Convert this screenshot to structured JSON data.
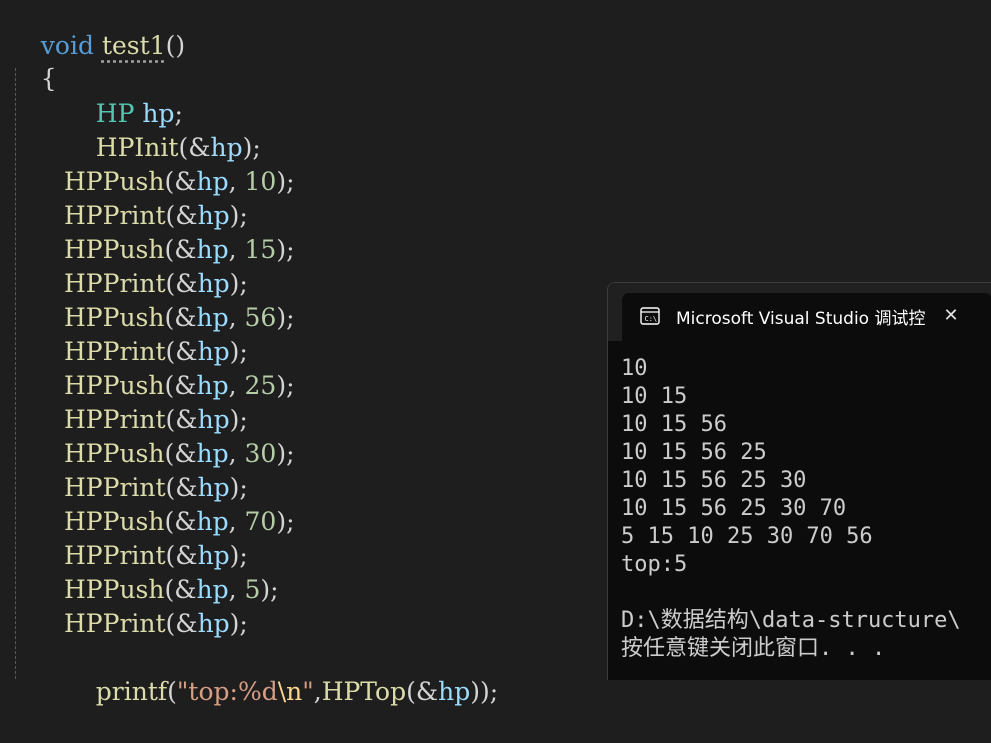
{
  "editor": {
    "fn_header": {
      "kw": "void",
      "name": "test1",
      "parens": "()"
    },
    "open_brace": "{",
    "decl": {
      "type": "HP",
      "var": "hp",
      "semi": ";"
    },
    "init": {
      "fn": "HPInit",
      "open": "(&",
      "var": "hp",
      "close": ");"
    },
    "lines": [
      {
        "fn": "HPPush",
        "arg": "10"
      },
      {
        "fn": "HPPrint"
      },
      {
        "fn": "HPPush",
        "arg": "15"
      },
      {
        "fn": "HPPrint"
      },
      {
        "fn": "HPPush",
        "arg": "56"
      },
      {
        "fn": "HPPrint"
      },
      {
        "fn": "HPPush",
        "arg": "25"
      },
      {
        "fn": "HPPrint"
      },
      {
        "fn": "HPPush",
        "arg": "30"
      },
      {
        "fn": "HPPrint"
      },
      {
        "fn": "HPPush",
        "arg": "70"
      },
      {
        "fn": "HPPrint"
      },
      {
        "fn": "HPPush",
        "arg": "5"
      },
      {
        "fn": "HPPrint"
      }
    ],
    "printf": {
      "fn": "printf",
      "open": "(",
      "str_a": "\"top:%d",
      "esc": "\\n",
      "str_b": "\"",
      "comma": ",",
      "call": "HPTop",
      "call_open": "(&",
      "var": "hp",
      "close": "));"
    }
  },
  "console": {
    "title": "Microsoft Visual Studio 调试控",
    "icon": "terminal-icon",
    "close_icon": "close-icon",
    "close_glyph": "✕",
    "output": [
      "10",
      "10 15",
      "10 15 56",
      "10 15 56 25",
      "10 15 56 25 30",
      "10 15 56 25 30 70",
      "5 15 10 25 30 70 56",
      "top:5",
      "",
      "D:\\数据结构\\data-structure\\",
      "按任意键关闭此窗口. . ."
    ]
  }
}
